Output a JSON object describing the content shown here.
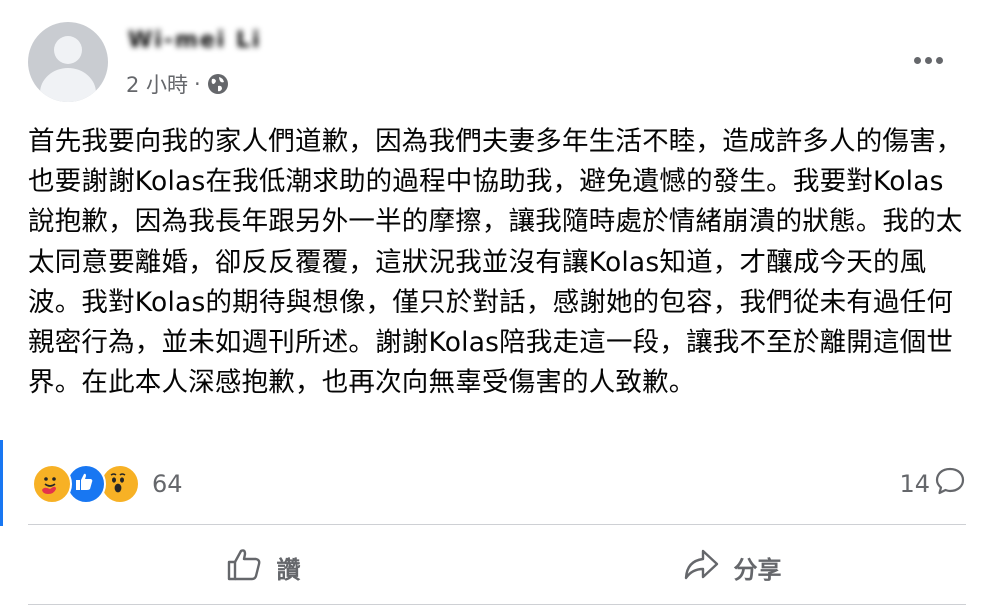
{
  "post": {
    "author_name": "Wi-mei Li",
    "timestamp": "2 小時",
    "meta_separator": "·",
    "privacy_icon": "globe-icon",
    "text": "首先我要向我的家人們道歉，因為我們夫妻多年生活不睦，造成許多人的傷害，也要謝謝Kolas在我低潮求助的過程中協助我，避免遺憾的發生。我要對Kolas說抱歉，因為我長年跟另外一半的摩擦，讓我隨時處於情緒崩潰的狀態。我的太太同意要離婚，卻反反覆覆，這狀況我並沒有讓Kolas知道，才釀成今天的風波。我對Kolas的期待與想像，僅只於對話，感謝她的包容，我們從未有過任何親密行為，並未如週刊所述。謝謝Kolas陪我走這一段，讓我不至於離開這個世界。在此本人深感抱歉，也再次向無辜受傷害的人致歉。"
  },
  "stats": {
    "reactions": [
      "care-reaction-icon",
      "like-reaction-icon",
      "wow-reaction-icon"
    ],
    "reaction_count": "64",
    "comment_count": "14"
  },
  "actions": {
    "like_label": "讚",
    "share_label": "分享"
  },
  "colors": {
    "accent": "#1877f2",
    "secondary_text": "#65676b",
    "reaction_yellow": "#f7b125"
  }
}
